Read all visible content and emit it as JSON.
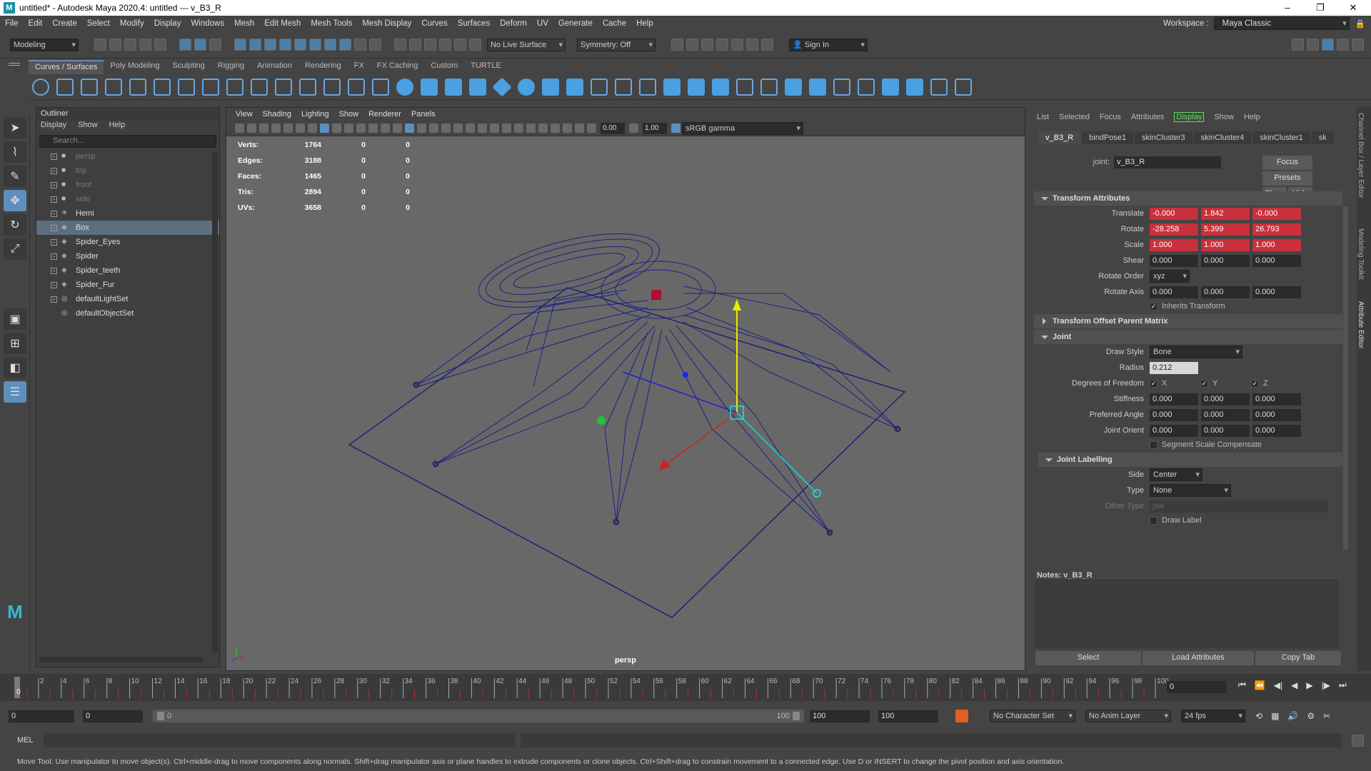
{
  "window": {
    "title": "untitled* - Autodesk Maya 2020.4: untitled  ---  v_B3_R",
    "controls": [
      "–",
      "❐",
      "✕"
    ]
  },
  "menubar": {
    "items": [
      "File",
      "Edit",
      "Create",
      "Select",
      "Modify",
      "Display",
      "Windows",
      "Mesh",
      "Edit Mesh",
      "Mesh Tools",
      "Mesh Display",
      "Curves",
      "Surfaces",
      "Deform",
      "UV",
      "Generate",
      "Cache",
      "Help"
    ],
    "workspace_label": "Workspace :",
    "workspace_value": "Maya Classic"
  },
  "statusline": {
    "mode": "Modeling",
    "live_surface": "No Live Surface",
    "symmetry": "Symmetry: Off",
    "sign_in": "Sign In"
  },
  "shelf": {
    "tabs": [
      "Curves / Surfaces",
      "Poly Modeling",
      "Sculpting",
      "Rigging",
      "Animation",
      "Rendering",
      "FX",
      "FX Caching",
      "Custom",
      "TURTLE"
    ],
    "active_tab": 0
  },
  "outliner": {
    "title": "Outliner",
    "menu": [
      "Display",
      "Show",
      "Help"
    ],
    "search_placeholder": "Search...",
    "items": [
      {
        "label": "persp",
        "icon": "camera-icon",
        "dim": true,
        "plus": true
      },
      {
        "label": "top",
        "icon": "camera-icon",
        "dim": true,
        "plus": true
      },
      {
        "label": "front",
        "icon": "camera-icon",
        "dim": true,
        "plus": true
      },
      {
        "label": "side",
        "icon": "camera-icon",
        "dim": true,
        "plus": true
      },
      {
        "label": "Hemi",
        "icon": "light-icon",
        "dim": false,
        "plus": true
      },
      {
        "label": "Box",
        "icon": "transform-icon",
        "dim": false,
        "plus": true,
        "selected": true
      },
      {
        "label": "Spider_Eyes",
        "icon": "transform-icon",
        "dim": false,
        "plus": true
      },
      {
        "label": "Spider",
        "icon": "transform-icon",
        "dim": false,
        "plus": true
      },
      {
        "label": "Spider_teeth",
        "icon": "transform-icon",
        "dim": false,
        "plus": true
      },
      {
        "label": "Spider_Fur",
        "icon": "transform-icon",
        "dim": false,
        "plus": true
      },
      {
        "label": "defaultLightSet",
        "icon": "set-icon",
        "dim": false,
        "plus": true
      },
      {
        "label": "defaultObjectSet",
        "icon": "set-icon",
        "dim": false,
        "plus": false
      }
    ]
  },
  "viewport": {
    "menu": [
      "View",
      "Shading",
      "Lighting",
      "Show",
      "Renderer",
      "Panels"
    ],
    "near_value": "0.00",
    "far_value": "1.00",
    "color_space": "sRGB gamma",
    "camera_label": "persp",
    "hud": [
      {
        "label": "Verts:",
        "v1": "1764",
        "v2": "0",
        "v3": "0"
      },
      {
        "label": "Edges:",
        "v1": "3188",
        "v2": "0",
        "v3": "0"
      },
      {
        "label": "Faces:",
        "v1": "1465",
        "v2": "0",
        "v3": "0"
      },
      {
        "label": "Tris:",
        "v1": "2894",
        "v2": "0",
        "v3": "0"
      },
      {
        "label": "UVs:",
        "v1": "3658",
        "v2": "0",
        "v3": "0"
      }
    ]
  },
  "attribute_editor": {
    "menu": [
      "List",
      "Selected",
      "Focus",
      "Attributes",
      "Display",
      "Show",
      "Help"
    ],
    "active_menu": "Display",
    "tabs": [
      "v_B3_R",
      "bindPose1",
      "skinCluster3",
      "skinCluster4",
      "skinCluster1",
      "sk"
    ],
    "node_type_label": "joint:",
    "node_name": "v_B3_R",
    "buttons": {
      "focus": "Focus",
      "presets": "Presets",
      "show": "Show",
      "hide": "Hide"
    },
    "transform": {
      "header": "Transform Attributes",
      "translate": {
        "label": "Translate",
        "x": "-0.000",
        "y": "1.842",
        "z": "-0.000"
      },
      "rotate": {
        "label": "Rotate",
        "x": "-28.258",
        "y": "5.399",
        "z": "26.793"
      },
      "scale": {
        "label": "Scale",
        "x": "1.000",
        "y": "1.000",
        "z": "1.000"
      },
      "shear": {
        "label": "Shear",
        "x": "0.000",
        "y": "0.000",
        "z": "0.000"
      },
      "rotate_order": {
        "label": "Rotate Order",
        "value": "xyz"
      },
      "rotate_axis": {
        "label": "Rotate Axis",
        "x": "0.000",
        "y": "0.000",
        "z": "0.000"
      },
      "inherits": "Inherits Transform"
    },
    "offset_header": "Transform Offset Parent Matrix",
    "joint": {
      "header": "Joint",
      "draw_style": {
        "label": "Draw Style",
        "value": "Bone"
      },
      "radius": {
        "label": "Radius",
        "value": "0.212"
      },
      "dof": {
        "label": "Degrees of Freedom",
        "x": "X",
        "y": "Y",
        "z": "Z"
      },
      "stiffness": {
        "label": "Stiffness",
        "x": "0.000",
        "y": "0.000",
        "z": "0.000"
      },
      "preferred": {
        "label": "Preferred Angle",
        "x": "0.000",
        "y": "0.000",
        "z": "0.000"
      },
      "orient": {
        "label": "Joint Orient",
        "x": "0.000",
        "y": "0.000",
        "z": "0.000"
      },
      "ssc": "Segment Scale Compensate"
    },
    "labelling": {
      "header": "Joint Labelling",
      "side": {
        "label": "Side",
        "value": "Center"
      },
      "type": {
        "label": "Type",
        "value": "None"
      },
      "other_type": {
        "label": "Other Type",
        "value": "jaw"
      },
      "draw_label": "Draw Label"
    },
    "notes_label": "Notes:  v_B3_R",
    "footer": {
      "select": "Select",
      "load": "Load Attributes",
      "copy": "Copy Tab"
    }
  },
  "side_tabs": [
    "Channel Box / Layer Editor",
    "Modeling Toolkit",
    "Attribute Editor"
  ],
  "timeline": {
    "ticks": [
      "2",
      "4",
      "6",
      "8",
      "10",
      "12",
      "14",
      "16",
      "18",
      "20",
      "22",
      "24",
      "26",
      "28",
      "30",
      "32",
      "34",
      "36",
      "38",
      "40",
      "42",
      "44",
      "46",
      "48",
      "50",
      "52",
      "54",
      "56",
      "58",
      "60",
      "62",
      "64",
      "66",
      "68",
      "70",
      "72",
      "74",
      "76",
      "78",
      "80",
      "82",
      "84",
      "86",
      "88",
      "90",
      "92",
      "94",
      "96",
      "98",
      "100"
    ],
    "current_frame": "0",
    "current_field": "0"
  },
  "range": {
    "start": "0",
    "playback_start": "0",
    "slider_left": "0",
    "slider_right": "100",
    "playback_end": "100",
    "end": "100",
    "character_set": "No Character Set",
    "anim_layer": "No Anim Layer",
    "fps": "24 fps"
  },
  "command": {
    "label": "MEL"
  },
  "help": {
    "text": "Move Tool: Use manipulator to move object(s). Ctrl+middle-drag to move components along normals. Shift+drag manipulator axis or plane handles to extrude components or clone objects. Ctrl+Shift+drag to constrain movement to a connected edge. Use D or INSERT to change the pivot position and axis orientation."
  },
  "colors": {
    "accent": "#5d8fbd",
    "keyed_red": "#c8303b",
    "wire": "#1b1b7a",
    "bg": "#444444"
  }
}
